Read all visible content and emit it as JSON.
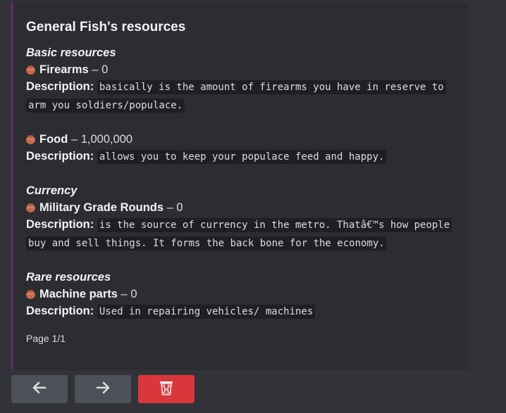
{
  "embed": {
    "title": "General Fish's resources",
    "sections": [
      {
        "title": "Basic resources",
        "items": [
          {
            "name": "Firearms",
            "value": "0",
            "description_label": "Description:",
            "description": "basically is the amount of firearms you have in reserve to arm you soldiers/populace."
          },
          {
            "name": "Food",
            "value": "1,000,000",
            "description_label": "Description:",
            "description": "allows you to keep your populace feed and happy."
          }
        ]
      },
      {
        "title": "Currency",
        "items": [
          {
            "name": "Military Grade Rounds",
            "value": "0",
            "description_label": "Description:",
            "description": "is the source of currency in the metro. Thatâ€™s how people buy and sell things. It forms the back bone for the economy."
          }
        ]
      },
      {
        "title": "Rare resources",
        "items": [
          {
            "name": "Machine parts",
            "value": "0",
            "description_label": "Description:",
            "description": "Used in repairing vehicles/ machines"
          }
        ]
      }
    ],
    "footer": "Page 1/1",
    "accent_color": "#5d2a63"
  },
  "item_icon": "amphora-icon",
  "buttons": {
    "previous_icon": "arrow-left-icon",
    "next_icon": "arrow-right-icon",
    "delete_icon": "wastebasket-icon",
    "delete_color": "#da373c"
  }
}
